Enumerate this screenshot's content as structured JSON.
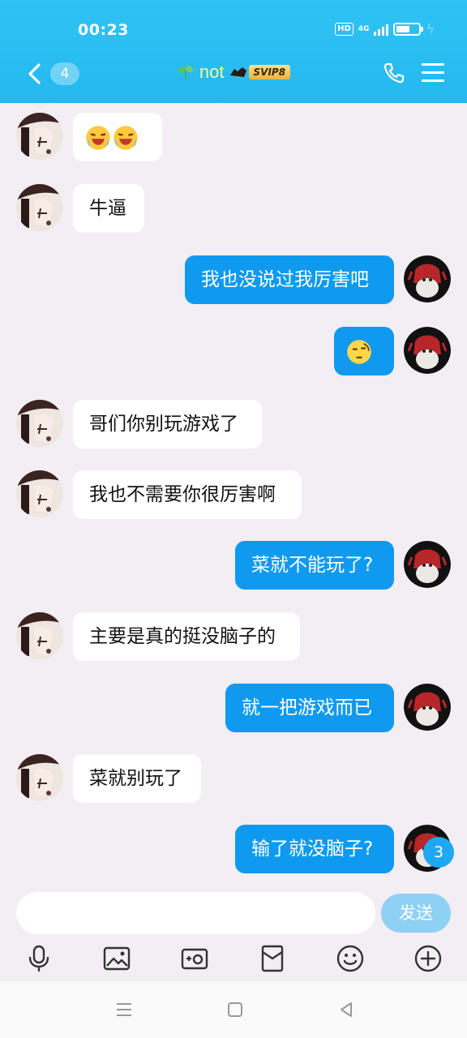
{
  "status_bar": {
    "time": "00:23",
    "hd": "HD",
    "network": "4G"
  },
  "header": {
    "badge": "4",
    "contact_name": "not",
    "vip_label": "SVIP8"
  },
  "messages": [
    {
      "side": "left",
      "type": "emoji"
    },
    {
      "side": "left",
      "type": "text",
      "text": "牛逼"
    },
    {
      "side": "right",
      "type": "text",
      "text": "我也没说过我厉害吧"
    },
    {
      "side": "right",
      "type": "emoji"
    },
    {
      "side": "left",
      "type": "text",
      "text": "哥们你别玩游戏了"
    },
    {
      "side": "left",
      "type": "text",
      "text": "我也不需要你很厉害啊"
    },
    {
      "side": "right",
      "type": "text",
      "text": "菜就不能玩了?"
    },
    {
      "side": "left",
      "type": "text",
      "text": "主要是真的挺没脑子的"
    },
    {
      "side": "right",
      "type": "text",
      "text": "就一把游戏而已"
    },
    {
      "side": "left",
      "type": "text",
      "text": "菜就别玩了"
    },
    {
      "side": "right",
      "type": "text",
      "text": "输了就没脑子?"
    }
  ],
  "composer": {
    "send_label": "发送",
    "unread_count": "3"
  },
  "colors": {
    "header": "#25b8f0",
    "outgoing_bubble": "#0f9af0",
    "incoming_bubble": "#ffffff",
    "background": "#f2eef3"
  }
}
